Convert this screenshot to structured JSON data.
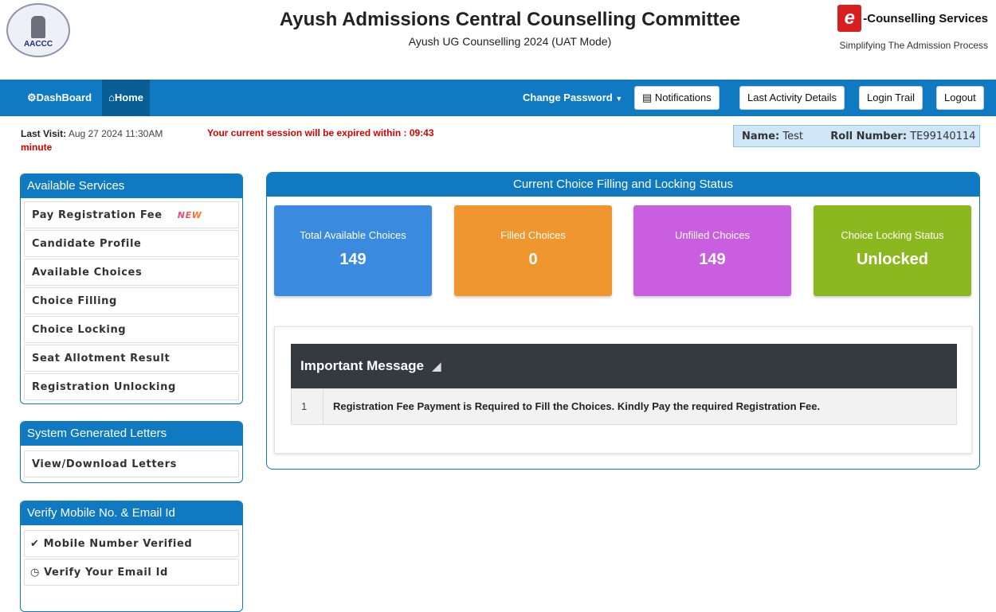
{
  "header": {
    "logo_text": "AACCC",
    "title": "Ayush Admissions Central Counselling Committee",
    "subtitle": "Ayush UG Counselling 2024 (UAT Mode)",
    "brand_letter": "e",
    "brand_name": "-Counselling Services",
    "brand_tagline": "Simplifying The Admission Process"
  },
  "nav": {
    "dashboard": "DashBoard",
    "home": "Home",
    "change_password": "Change Password",
    "notifications": "Notifications",
    "last_activity": "Last Activity Details",
    "login_trail": "Login Trail",
    "logout": "Logout"
  },
  "info": {
    "last_visit_label": "Last Visit:",
    "last_visit_value": "Aug 27 2024 11:30AM",
    "minute": "minute",
    "session_text": "Your current session will be expired within : 09:43",
    "name_label": "Name:",
    "name_value": "Test",
    "roll_label": "Roll Number:",
    "roll_value": "TE99140114"
  },
  "services": {
    "title": "Available Services",
    "new_tag": "NEW",
    "items": [
      {
        "label": "Pay Registration Fee"
      },
      {
        "label": "Candidate Profile"
      },
      {
        "label": "Available Choices"
      },
      {
        "label": "Choice Filling"
      },
      {
        "label": "Choice Locking"
      },
      {
        "label": "Seat Allotment Result"
      },
      {
        "label": "Registration Unlocking"
      }
    ]
  },
  "letters": {
    "title": "System Generated Letters",
    "items": [
      {
        "label": "View/Download Letters"
      }
    ]
  },
  "verify": {
    "title": "Verify Mobile No. & Email Id",
    "items": [
      {
        "label": "Mobile Number Verified"
      },
      {
        "label": "Verify Your Email Id"
      }
    ]
  },
  "status": {
    "title": "Current Choice Filling and Locking Status",
    "cards": [
      {
        "label": "Total Available Choices",
        "value": "149",
        "color": "#3a8be0"
      },
      {
        "label": "Filled Choices",
        "value": "0",
        "color": "#f0962e"
      },
      {
        "label": "Unfilled Choices",
        "value": "149",
        "color": "#c95fe0"
      },
      {
        "label": "Choice Locking Status",
        "value": "Unlocked",
        "color": "#8bb81f"
      }
    ]
  },
  "message": {
    "title": "Important Message",
    "rows": [
      {
        "num": "1",
        "text": "Registration Fee Payment is Required to Fill the Choices. Kindly Pay the required Registration Fee."
      }
    ]
  }
}
